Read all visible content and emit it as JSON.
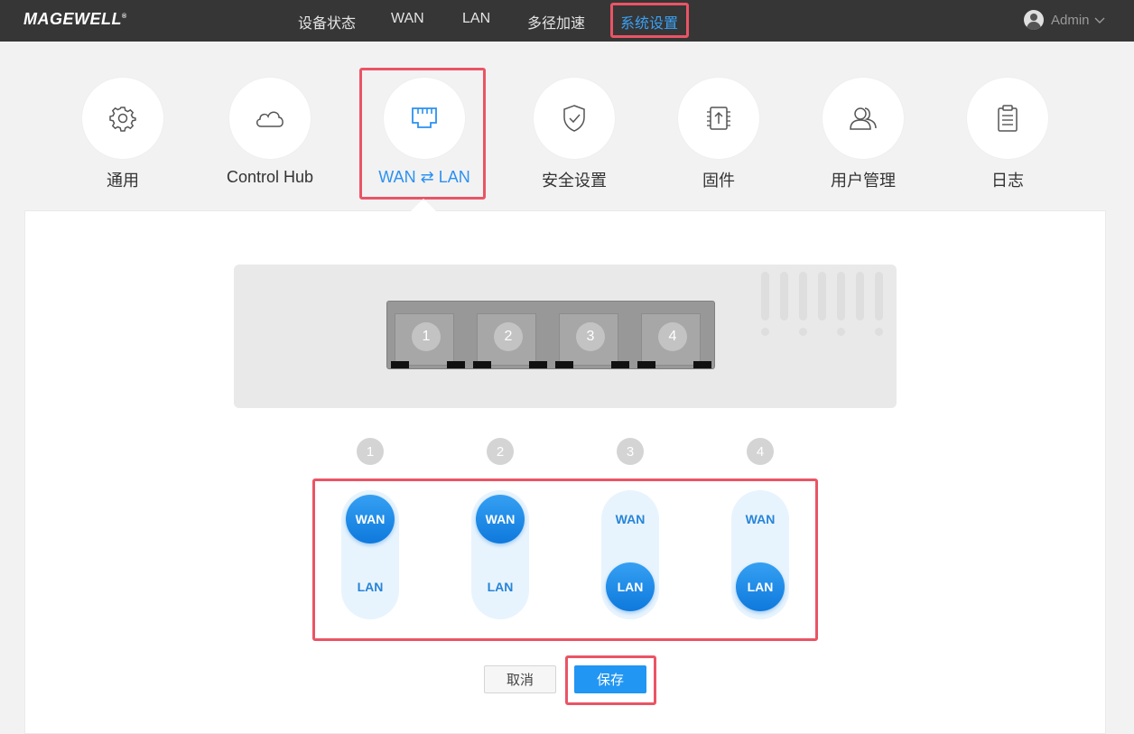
{
  "brand": {
    "logo_text": "MAGEWELL",
    "logo_mark": "®"
  },
  "nav": {
    "items": [
      {
        "label": "设备状态"
      },
      {
        "label": "WAN"
      },
      {
        "label": "LAN"
      },
      {
        "label": "多径加速"
      },
      {
        "label": "系统设置",
        "active": true
      }
    ]
  },
  "user": {
    "name": "Admin",
    "icon": "user-avatar-icon",
    "dropdown_icon": "chevron-down-icon"
  },
  "categories": [
    {
      "label": "通用",
      "icon": "gear-icon"
    },
    {
      "label": "Control Hub",
      "icon": "cloud-icon"
    },
    {
      "label": "WAN ⇄ LAN",
      "icon": "ethernet-port-icon",
      "active": true
    },
    {
      "label": "安全设置",
      "icon": "shield-check-icon"
    },
    {
      "label": "固件",
      "icon": "chip-upload-icon"
    },
    {
      "label": "用户管理",
      "icon": "users-icon"
    },
    {
      "label": "日志",
      "icon": "clipboard-icon"
    }
  ],
  "device": {
    "ports": [
      "1",
      "2",
      "3",
      "4"
    ]
  },
  "port_switches": [
    {
      "number": "1",
      "wan_label": "WAN",
      "lan_label": "LAN",
      "selected": "WAN"
    },
    {
      "number": "2",
      "wan_label": "WAN",
      "lan_label": "LAN",
      "selected": "WAN"
    },
    {
      "number": "3",
      "wan_label": "WAN",
      "lan_label": "LAN",
      "selected": "LAN"
    },
    {
      "number": "4",
      "wan_label": "WAN",
      "lan_label": "LAN",
      "selected": "LAN"
    }
  ],
  "actions": {
    "cancel_label": "取消",
    "save_label": "保存"
  },
  "colors": {
    "accent": "#2196f3",
    "highlight": "#ea5465",
    "topbar": "#363636"
  }
}
